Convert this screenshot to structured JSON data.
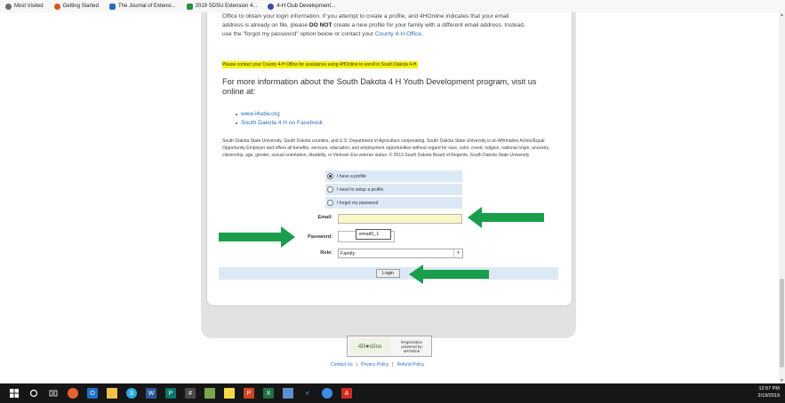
{
  "bookmarks": [
    {
      "label": "Most Visited",
      "color": "#6b6b6b"
    },
    {
      "label": "Getting Started",
      "color": "#d9531e"
    },
    {
      "label": "The Journal of Extensi...",
      "color": "#2a6ebb"
    },
    {
      "label": "2019 SDSU Extension 4...",
      "color": "#2a8f3c"
    },
    {
      "label": "4-H Club Development...",
      "color": "#3b4fa0"
    }
  ],
  "intro": {
    "line1": "Office to obtain your login information. If you attempt to create a profile, and 4HOnline indicates that your email",
    "line2a": "address is already on file, please ",
    "line2b": "DO NOT",
    "line2c": " create a new profile for your family with a different email address. Instead,",
    "line3a": "use the \"forgot my password\" option below or contact your ",
    "line3link": "County 4-H Office",
    "line3end": "."
  },
  "highlight": "Please contact your County 4-H Office for assistance using 4HOnline to enroll in South Dakota 4-H.",
  "more_info": "For more information about the South Dakota 4 H Youth Development program, visit us online at:",
  "links": [
    "www.i4sdw.org",
    "South Dakota 4 H on Facebook"
  ],
  "legal": "South Dakota State University, South Dakota counties, and U.S. Department of Agriculture cooperating. South Dakota State University is an Affirmative Action/Equal Opportunity Employer and offers all benefits, services, education, and employment opportunities without regard for race, color, creed, religion, national origin, ancestry, citizenship, age, gender, sexual orientation, disability, or Vietnam Era veteran status. © 2013 South Dakota Board of Regents, South Dakota State University",
  "login": {
    "options": [
      "I have a profile",
      "I need to setup a profile",
      "I forgot my password"
    ],
    "selected": 0,
    "email_label": "Email:",
    "email_value": "",
    "password_label": "Password:",
    "password_value": "",
    "tooltip": "email0_1",
    "role_label": "Role:",
    "role_value": "Family",
    "login_button": "Login"
  },
  "annotation_color": "#1a9e4b",
  "footer": {
    "logo_text": "4H●nline",
    "logo_caption_1": "Registration",
    "logo_caption_2": "powered by",
    "logo_caption_3": "4HOnline",
    "links": [
      "Contact Us",
      "Privacy Policy",
      "Refund Policy"
    ]
  },
  "taskbar": {
    "time": "12:57 PM",
    "date": "2/19/2019"
  }
}
